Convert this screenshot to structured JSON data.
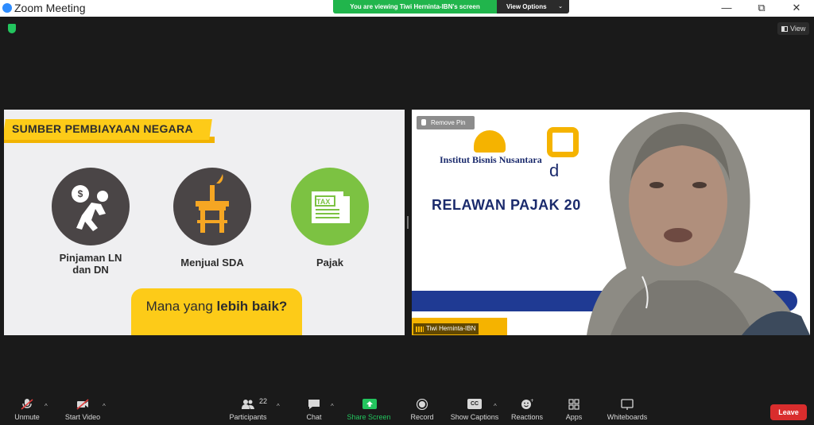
{
  "window": {
    "title": "Zoom Meeting",
    "minimize": "—",
    "restore": "⧉",
    "close": "✕"
  },
  "share": {
    "banner": "You are viewing Tiwi Herninta-IBN's screen",
    "view_options": "View Options",
    "view_button": "View"
  },
  "slide": {
    "title": "SUMBER PEMBIAYAAN NEGARA",
    "items": [
      {
        "label_line1": "Pinjaman LN",
        "label_line2": "dan DN"
      },
      {
        "label_line1": "Menjual SDA"
      },
      {
        "label_line1": "Pajak",
        "icon_text": "TAX"
      }
    ],
    "question_normal": "Mana yang ",
    "question_bold": "lebih baik?"
  },
  "video": {
    "remove_pin": "Remove Pin",
    "logo_name": "Institut Bisnis Nusantara",
    "letter": "d",
    "headline": "RELAWAN PAJAK 20",
    "participant_name": "Tiwi Herninta-IBN"
  },
  "toolbar": {
    "unmute": "Unmute",
    "start_video": "Start Video",
    "participants": "Participants",
    "participants_count": "22",
    "chat": "Chat",
    "share_screen": "Share Screen",
    "record": "Record",
    "show_captions": "Show Captions",
    "captions_icon_text": "CC",
    "reactions": "Reactions",
    "apps": "Apps",
    "whiteboards": "Whiteboards",
    "leave": "Leave"
  },
  "colors": {
    "zoom_blue": "#2d8cff",
    "share_green": "#21b54c",
    "slide_yellow": "#fdcb18",
    "tax_green": "#7cc242",
    "leave_red": "#d92d2d",
    "ibn_navy": "#1a2a6c"
  }
}
